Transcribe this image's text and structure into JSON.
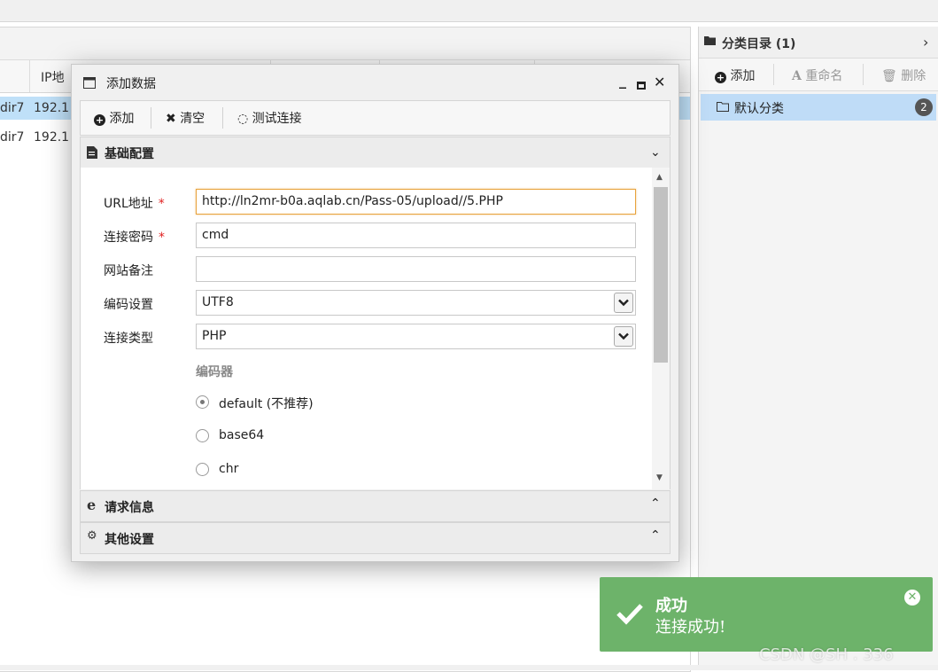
{
  "background": {
    "grid": {
      "ip_header": "IP地",
      "rows": [
        {
          "col1": "dir7",
          "col2": "192.1",
          "selected": true
        },
        {
          "col1": "dir7",
          "col2": "192.1",
          "selected": false
        }
      ]
    },
    "category_panel": {
      "title": "分类目录 (1)",
      "toolbar": {
        "add": "添加",
        "rename": "重命名",
        "delete": "删除"
      },
      "items": [
        {
          "label": "默认分类",
          "count": "2"
        }
      ]
    }
  },
  "dialog": {
    "title": "添加数据",
    "toolbar": {
      "add": "添加",
      "clear": "清空",
      "test": "测试连接"
    },
    "sections": {
      "basic": "基础配置",
      "request": "请求信息",
      "other": "其他设置"
    },
    "form": {
      "url_label": "URL地址",
      "url_value": "http://ln2mr-b0a.aqlab.cn/Pass-05/upload//5.PHP",
      "password_label": "连接密码",
      "password_value": "cmd",
      "note_label": "网站备注",
      "note_value": "",
      "encoding_label": "编码设置",
      "encoding_value": "UTF8",
      "type_label": "连接类型",
      "type_value": "PHP",
      "encoder_title": "编码器",
      "required_mark": "*",
      "encoders": [
        {
          "label": "default (不推荐)",
          "checked": true
        },
        {
          "label": "base64",
          "checked": false
        },
        {
          "label": "chr",
          "checked": false
        }
      ]
    }
  },
  "toast": {
    "title": "成功",
    "message": "连接成功!",
    "color": "#6db36a"
  },
  "watermark": "CSDN @SH    . 336"
}
